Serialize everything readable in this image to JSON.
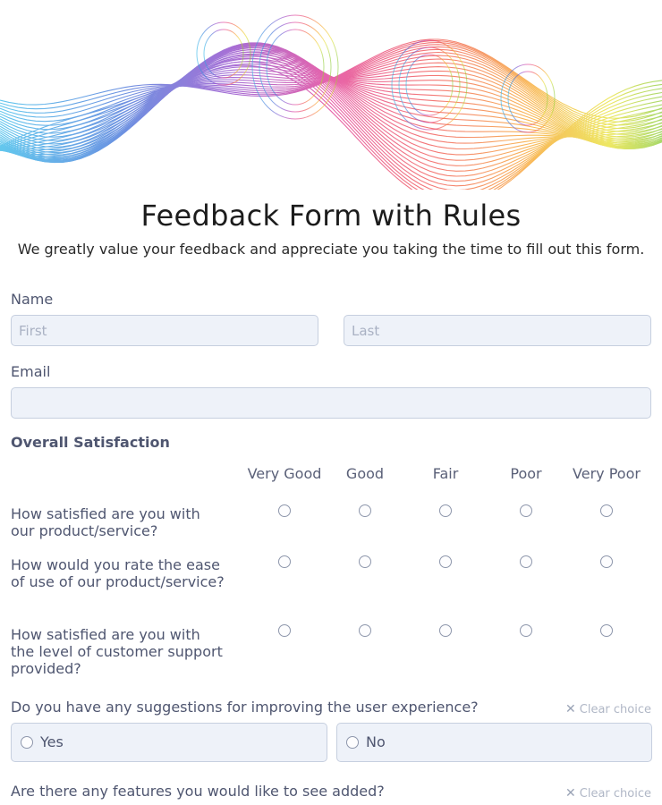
{
  "form": {
    "title": "Feedback Form with Rules",
    "subtitle": "We greatly value your feedback and appreciate you taking the time to fill out this form."
  },
  "name_field": {
    "label": "Name",
    "first_placeholder": "First",
    "last_placeholder": "Last"
  },
  "email_field": {
    "label": "Email",
    "value": ""
  },
  "satisfaction": {
    "section_title": "Overall Satisfaction",
    "columns": [
      "Very Good",
      "Good",
      "Fair",
      "Poor",
      "Very Poor"
    ],
    "rows": [
      "How satisfied are you with our product/service?",
      "How would you rate the ease of use of our product/service?",
      "How satisfied are you with the level of customer support provided?"
    ]
  },
  "q_suggestions": {
    "question": "Do you have any suggestions for improving the user experience?",
    "clear_label": "Clear choice",
    "options": [
      "Yes",
      "No"
    ]
  },
  "q_features": {
    "question": "Are there any features you would like to see added?",
    "clear_label": "Clear choice"
  },
  "colors": {
    "input_bg": "#eef2f9",
    "input_border": "#c6cfdf",
    "label_text": "#4f5670",
    "title_text": "#1c1c1c"
  },
  "icons": {
    "radio": "radio-circle",
    "clear": "close-icon"
  }
}
